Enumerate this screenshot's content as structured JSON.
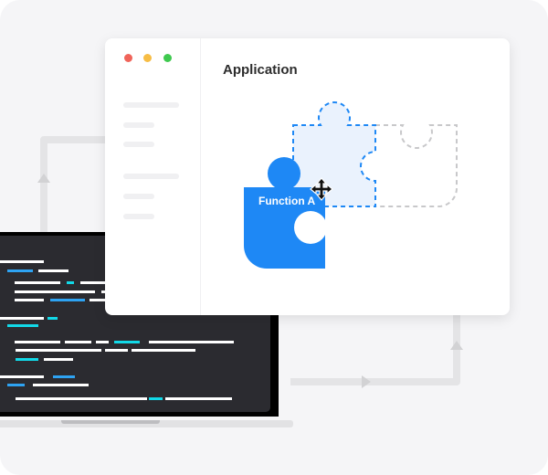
{
  "window": {
    "title": "Application",
    "traffic_lights": {
      "close": "#f0645a",
      "minimize": "#f7bd45",
      "maximize": "#3fc94f"
    }
  },
  "puzzle": {
    "function_label": "Function A",
    "accent": "#1e88f5",
    "placeholder_fill": "#eaf2fd",
    "empty_slot_stroke": "#c8c8ca"
  },
  "cursor": {
    "icon": "move-cursor-icon"
  },
  "colors": {
    "background": "#f5f5f7",
    "connector": "#e4e4e6",
    "code_bg": "#2b2b30",
    "code_blue": "#2ea3f2",
    "code_cyan": "#12d9e8"
  }
}
